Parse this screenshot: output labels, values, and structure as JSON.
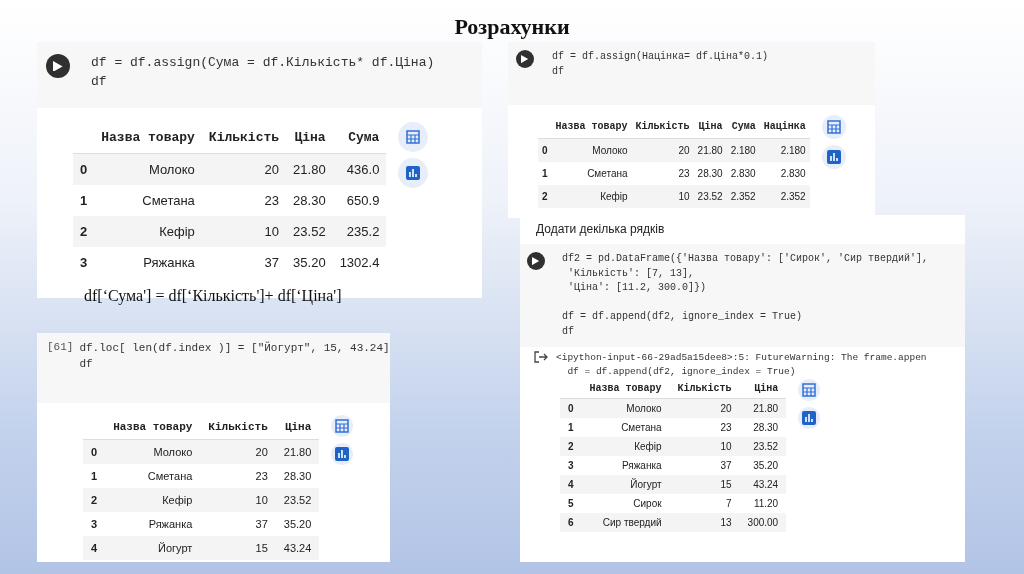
{
  "slide_title": "Розрахунки",
  "cells": [
    {
      "kind": "button",
      "code": [
        [
          "df = df.assign(Сума = df.Кількість* df.Ціна)",
          "df"
        ]
      ],
      "table": {
        "columns": [
          "Назва товару",
          "Кількість",
          "Ціна",
          "Сума"
        ],
        "rows": [
          {
            "index": "0",
            "cells": [
              "Молоко",
              "20",
              "21.80",
              "436.0"
            ]
          },
          {
            "index": "1",
            "cells": [
              "Сметана",
              "23",
              "28.30",
              "650.9"
            ]
          },
          {
            "index": "2",
            "cells": [
              "Кефір",
              "10",
              "23.52",
              "235.2"
            ]
          },
          {
            "index": "3",
            "cells": [
              "Ряжанка",
              "37",
              "35.20",
              "1302.4"
            ]
          }
        ]
      }
    },
    {
      "kind": "button",
      "code": [
        [
          "df = df.assign(Націнка= df.Ціна*0.1)",
          "df"
        ]
      ],
      "table": {
        "columns": [
          "Назва товару",
          "Кількість",
          "Ціна",
          "Сума",
          "Націнка"
        ],
        "rows": [
          {
            "index": "0",
            "cells": [
              "Молоко",
              "20",
              "21.80",
              "2.180",
              "2.180"
            ]
          },
          {
            "index": "1",
            "cells": [
              "Сметана",
              "23",
              "28.30",
              "2.830",
              "2.830"
            ]
          },
          {
            "index": "2",
            "cells": [
              "Кефір",
              "10",
              "23.52",
              "2.352",
              "2.352"
            ]
          }
        ]
      }
    },
    {
      "kind": "counter",
      "counter": "[61]",
      "code": [
        [
          "df.loc[ len(df.index )] = [\"Йогурт\", 15, 43.24]",
          "df"
        ]
      ],
      "table": {
        "columns": [
          "Назва товару",
          "Кількість",
          "Ціна"
        ],
        "rows": [
          {
            "index": "0",
            "cells": [
              "Молоко",
              "20",
              "21.80"
            ]
          },
          {
            "index": "1",
            "cells": [
              "Сметана",
              "23",
              "28.30"
            ]
          },
          {
            "index": "2",
            "cells": [
              "Кефір",
              "10",
              "23.52"
            ]
          },
          {
            "index": "3",
            "cells": [
              "Ряжанка",
              "37",
              "35.20"
            ]
          },
          {
            "index": "4",
            "cells": [
              "Йогурт",
              "15",
              "43.24"
            ]
          }
        ]
      }
    },
    {
      "kind": "button",
      "header": "Додати декілька рядків",
      "code": [
        [
          "df2 = pd.DataFrame({'Назва товару': ['Сирок', 'Сир твердий'],",
          " 'Кількість': [7, 13],",
          " 'Ціна': [11.2, 300.0]})"
        ],
        [
          "df = df.append(df2, ignore_index = True)",
          "df"
        ]
      ],
      "warning": [
        "<ipython-input-66-29ad5a15dee8>:5: FutureWarning: The frame.appen",
        "  df = df.append(df2, ignore_index = True)"
      ],
      "table": {
        "columns": [
          "Назва товару",
          "Кількість",
          "Ціна"
        ],
        "rows": [
          {
            "index": "0",
            "cells": [
              "Молоко",
              "20",
              "21.80"
            ]
          },
          {
            "index": "1",
            "cells": [
              "Сметана",
              "23",
              "28.30"
            ]
          },
          {
            "index": "2",
            "cells": [
              "Кефір",
              "10",
              "23.52"
            ]
          },
          {
            "index": "3",
            "cells": [
              "Ряжанка",
              "37",
              "35.20"
            ]
          },
          {
            "index": "4",
            "cells": [
              "Йогурт",
              "15",
              "43.24"
            ]
          },
          {
            "index": "5",
            "cells": [
              "Сирок",
              "7",
              "11.20"
            ]
          },
          {
            "index": "6",
            "cells": [
              "Сир твердий",
              "13",
              "300.00"
            ]
          }
        ]
      }
    }
  ],
  "caption": "df[‘Сума'] = df[‘Кількість']+ df[‘Ціна']"
}
